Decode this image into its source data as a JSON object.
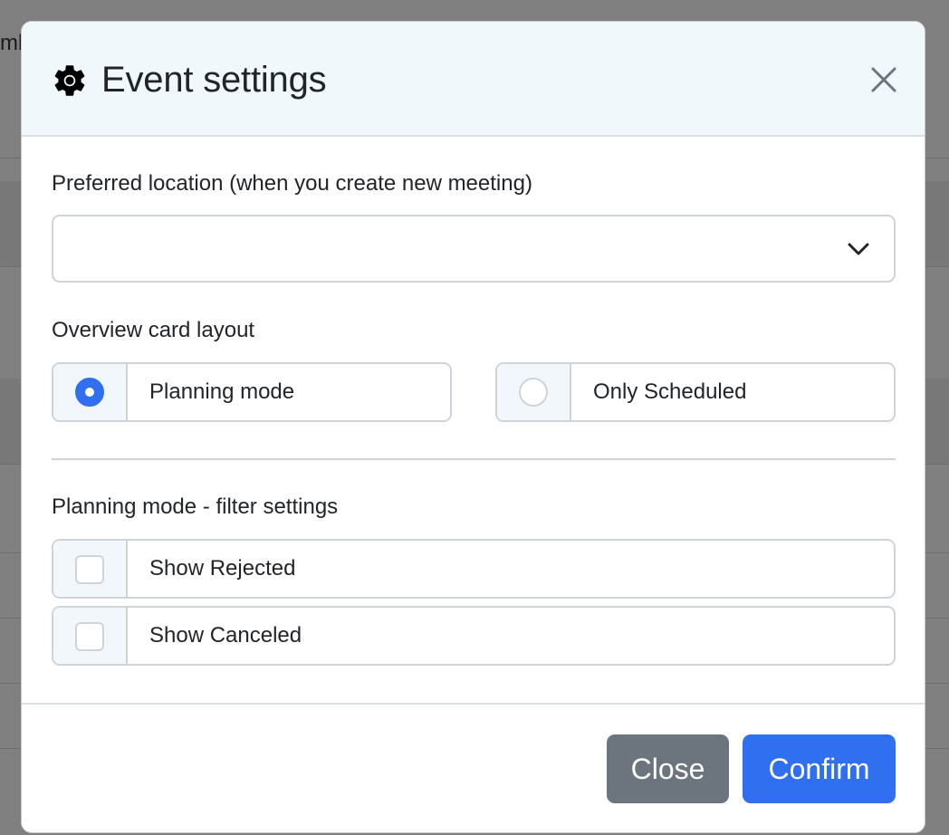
{
  "background": {
    "partial_text": "mb"
  },
  "modal": {
    "title": "Event settings",
    "icons": {
      "header": "gear-icon",
      "close": "close-icon",
      "select": "chevron-down-icon"
    },
    "preferred_location": {
      "label": "Preferred location (when you create new meeting)",
      "value": ""
    },
    "overview_layout": {
      "label": "Overview card layout",
      "options": [
        {
          "label": "Planning mode",
          "checked": true
        },
        {
          "label": "Only Scheduled",
          "checked": false
        }
      ]
    },
    "filter_settings": {
      "label": "Planning mode - filter settings",
      "options": [
        {
          "label": "Show Rejected",
          "checked": false
        },
        {
          "label": "Show Canceled",
          "checked": false
        }
      ]
    },
    "footer": {
      "close_label": "Close",
      "confirm_label": "Confirm"
    },
    "colors": {
      "primary": "#2f6ff0",
      "secondary": "#6c757d",
      "header_bg": "#f0f8fc",
      "overlay": "#808080"
    }
  }
}
